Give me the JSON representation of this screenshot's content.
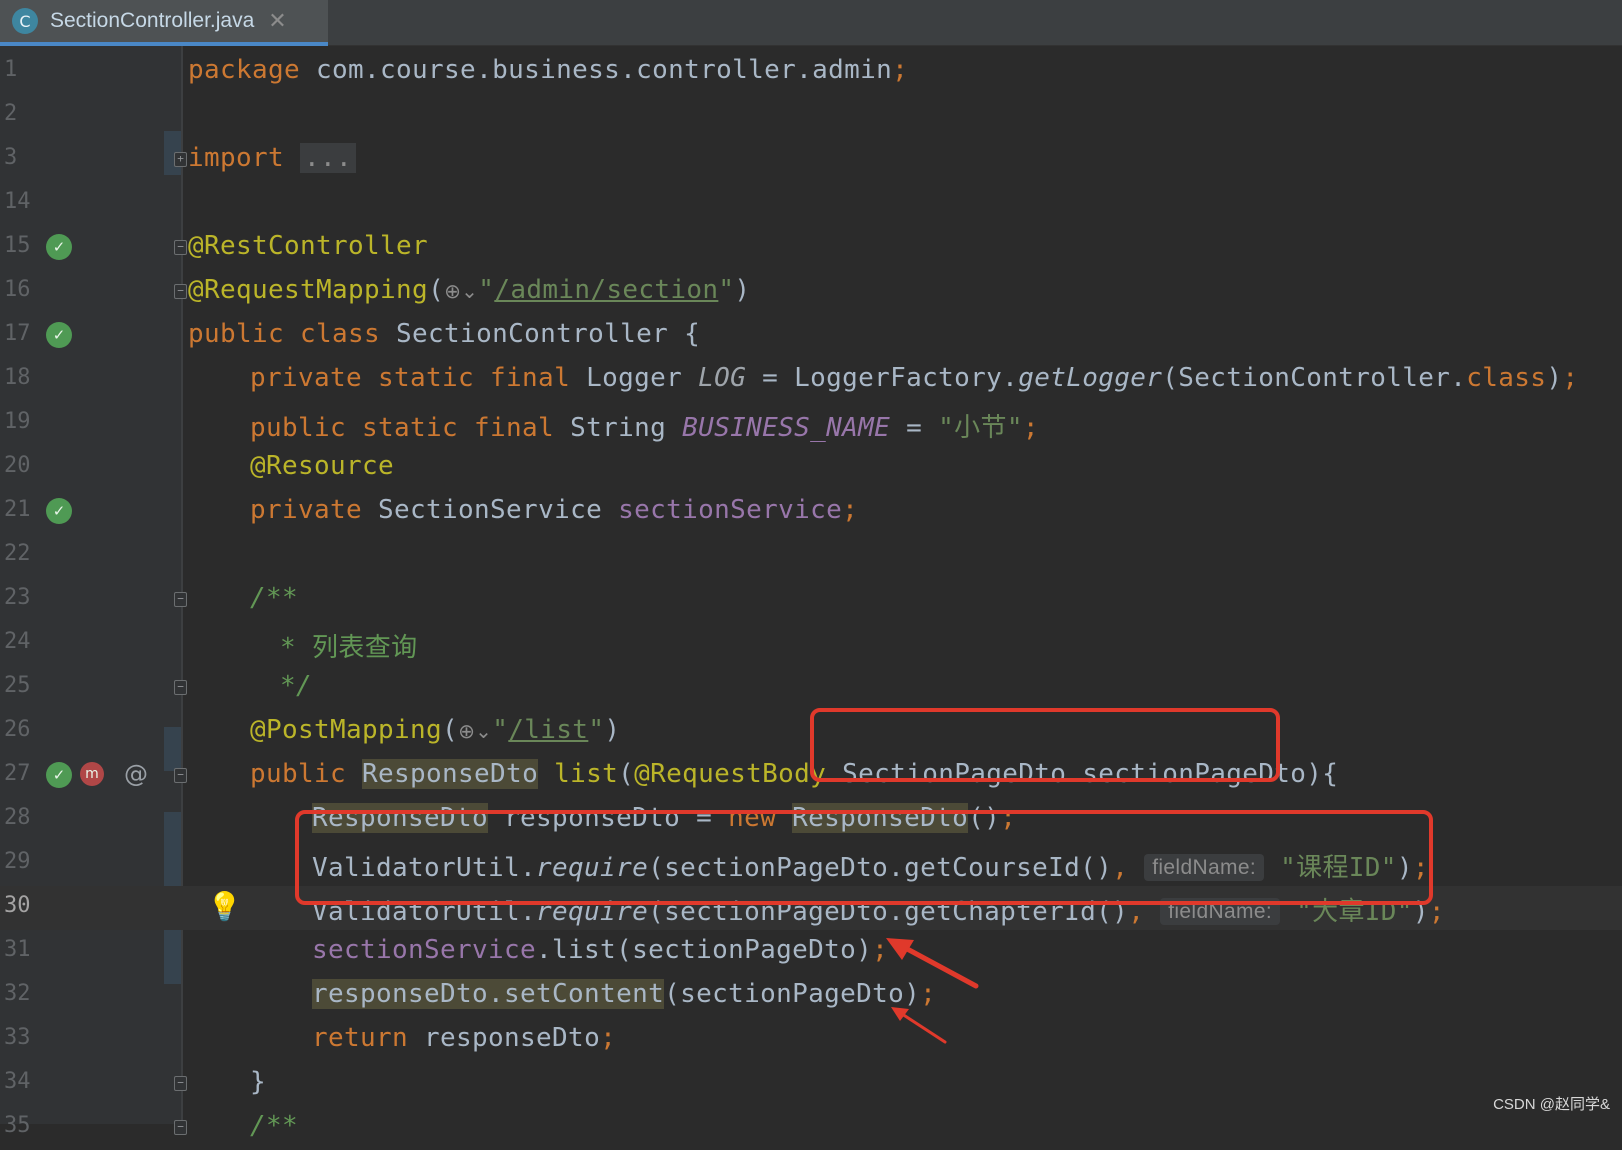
{
  "tab": {
    "icon_letter": "C",
    "filename": "SectionController.java",
    "close_glyph": "✕"
  },
  "lines": [
    {
      "n": "1",
      "segs": [
        [
          "kw",
          "package "
        ],
        [
          "",
          "com.course.business.controller.admin"
        ],
        [
          "kw",
          ";"
        ]
      ]
    },
    {
      "n": "2",
      "segs": []
    },
    {
      "n": "3",
      "segs": [
        [
          "kw",
          "import "
        ],
        [
          "fold-dots",
          "..."
        ]
      ]
    },
    {
      "n": "14",
      "segs": []
    },
    {
      "n": "15",
      "segs": [
        [
          "an",
          "@RestController"
        ]
      ]
    },
    {
      "n": "16",
      "segs": [
        [
          "an",
          "@RequestMapping"
        ],
        [
          "",
          "("
        ],
        [
          "globe",
          "⊕⌄"
        ],
        [
          "str",
          "\""
        ],
        [
          "url",
          "/admin/section"
        ],
        [
          "str",
          "\""
        ],
        [
          "",
          ")"
        ]
      ]
    },
    {
      "n": "17",
      "segs": [
        [
          "kw",
          "public class "
        ],
        [
          "",
          "SectionController {"
        ]
      ]
    },
    {
      "n": "18",
      "segs": [
        [
          "kw",
          "private static final "
        ],
        [
          "",
          "Logger "
        ],
        [
          "grey-it",
          "LOG"
        ],
        [
          "",
          " = LoggerFactory."
        ],
        [
          "ital",
          "getLogger"
        ],
        [
          "",
          "(SectionController."
        ],
        [
          "kw",
          "class"
        ],
        [
          "",
          ")"
        ],
        [
          "kw",
          ";"
        ]
      ]
    },
    {
      "n": "19",
      "segs": [
        [
          "kw",
          "public static final "
        ],
        [
          "",
          "String "
        ],
        [
          "ifld",
          "BUSINESS_NAME"
        ],
        [
          "",
          " = "
        ],
        [
          "str",
          "\"小节\""
        ],
        [
          "kw",
          ";"
        ]
      ]
    },
    {
      "n": "20",
      "segs": [
        [
          "an",
          "@Resource"
        ]
      ]
    },
    {
      "n": "21",
      "segs": [
        [
          "kw",
          "private "
        ],
        [
          "",
          "SectionService "
        ],
        [
          "fld",
          "sectionService"
        ],
        [
          "kw",
          ";"
        ]
      ]
    },
    {
      "n": "22",
      "segs": []
    },
    {
      "n": "23",
      "segs": [
        [
          "cm",
          "/**"
        ]
      ]
    },
    {
      "n": "24",
      "segs": [
        [
          "cm",
          " * "
        ],
        [
          "cmt",
          "列表查询"
        ]
      ]
    },
    {
      "n": "25",
      "segs": [
        [
          "cm",
          " */"
        ]
      ]
    },
    {
      "n": "26",
      "segs": [
        [
          "an",
          "@PostMapping"
        ],
        [
          "",
          "("
        ],
        [
          "globe",
          "⊕⌄"
        ],
        [
          "str",
          "\""
        ],
        [
          "url",
          "/list"
        ],
        [
          "str",
          "\""
        ],
        [
          "",
          ")"
        ]
      ]
    },
    {
      "n": "27",
      "segs": [
        [
          "kw",
          "public "
        ],
        [
          "hl",
          "ResponseDto"
        ],
        [
          "an",
          " list"
        ],
        [
          "",
          "("
        ],
        [
          "an",
          "@RequestBody "
        ],
        [
          "",
          "SectionPageDto sectionPageDto){"
        ]
      ]
    },
    {
      "n": "28",
      "segs": [
        [
          "hl",
          "ResponseDto"
        ],
        [
          "",
          " responseDto = "
        ],
        [
          "kw",
          "new "
        ],
        [
          "hl",
          "ResponseDto"
        ],
        [
          "",
          "()"
        ],
        [
          "kw",
          ";"
        ]
      ]
    },
    {
      "n": "29",
      "segs": [
        [
          "",
          "ValidatorUtil."
        ],
        [
          "ital",
          "require"
        ],
        [
          "",
          "(sectionPageDto.getCourseId()"
        ],
        [
          "kw",
          ", "
        ],
        [
          "hint",
          "fieldName:"
        ],
        [
          "str",
          " \"课程ID\""
        ],
        [
          "",
          ")"
        ],
        [
          "kw",
          ";"
        ]
      ]
    },
    {
      "n": "30",
      "segs": [
        [
          "",
          "ValidatorUtil."
        ],
        [
          "ital",
          "require"
        ],
        [
          "",
          "(sectionPageDto.getChapterId()"
        ],
        [
          "kw",
          ", "
        ],
        [
          "hint",
          "fieldName:"
        ],
        [
          "str",
          " \"大章ID\""
        ],
        [
          "",
          ")"
        ],
        [
          "kw",
          ";"
        ]
      ]
    },
    {
      "n": "31",
      "segs": [
        [
          "fld",
          "sectionService"
        ],
        [
          "",
          ".list(sectionPageDto)"
        ],
        [
          "kw",
          ";"
        ]
      ]
    },
    {
      "n": "32",
      "segs": [
        [
          "hl",
          "responseDto.setContent"
        ],
        [
          "",
          "(sectionPageDto)"
        ],
        [
          "kw",
          ";"
        ]
      ]
    },
    {
      "n": "33",
      "segs": [
        [
          "kw",
          "return "
        ],
        [
          "",
          "responseDto"
        ],
        [
          "kw",
          ";"
        ]
      ]
    },
    {
      "n": "34",
      "segs": [
        [
          "",
          "}"
        ]
      ]
    },
    {
      "n": "35",
      "segs": [
        [
          "cm",
          "/**"
        ]
      ]
    }
  ],
  "gutter_icons": {
    "bean_icon": "✓",
    "method_icon": "m",
    "at_symbol": "@",
    "bulb": "💡",
    "fold_plus": "+",
    "fold_minus": "−"
  },
  "watermark": "CSDN @赵同学&",
  "colors": {
    "annotation_red": "#e0392b",
    "keyword": "#cc7832",
    "string": "#6a8759",
    "field": "#9876aa",
    "annotation": "#bbb529"
  }
}
